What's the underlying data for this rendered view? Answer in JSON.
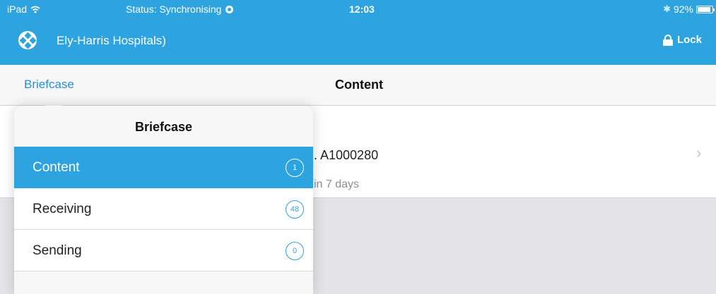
{
  "status_bar": {
    "device": "iPad",
    "wifi_icon": "wifi-icon",
    "status": "Status: Synchronising",
    "sync_icon": "sync-icon",
    "time": "12:03",
    "bluetooth_icon": "bluetooth-icon",
    "battery": "92%",
    "battery_level": 0.92
  },
  "nav": {
    "logo_icon": "hospital-logo-icon",
    "org_name": "Ely-Harris Hospitals)",
    "lock_label": "Lock",
    "lock_icon": "lock-icon"
  },
  "toolbar": {
    "back_label": "Briefcase",
    "title": "Content"
  },
  "content": {
    "row_title": ". A1000280",
    "row_subtitle": "in 7 days",
    "chevron": "›"
  },
  "popover": {
    "title": "Briefcase",
    "items": [
      {
        "label": "Content",
        "count": "1",
        "active": true
      },
      {
        "label": "Receiving",
        "count": "48",
        "active": false
      },
      {
        "label": "Sending",
        "count": "0",
        "active": false
      }
    ]
  },
  "colors": {
    "brand": "#2da3df",
    "link": "#2a8fd0",
    "background": "#e4e4e8"
  }
}
